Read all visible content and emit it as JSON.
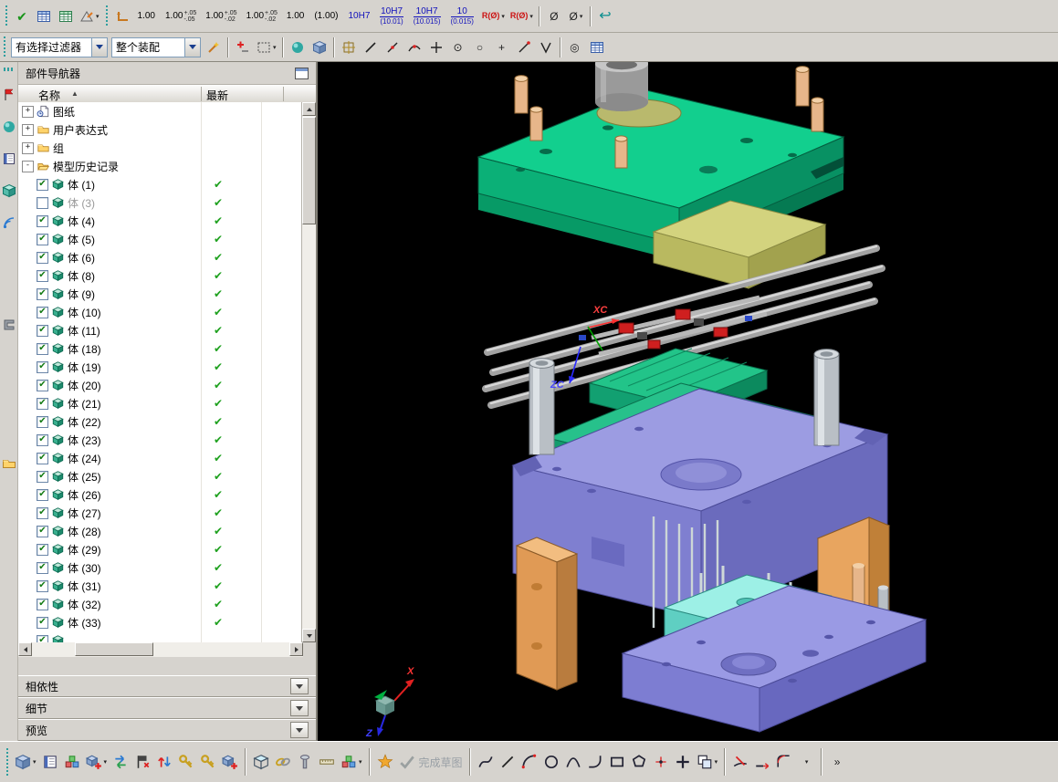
{
  "navigator": {
    "title": "部件导航器",
    "columns": {
      "name": "名称",
      "sort": "▲",
      "latest": "最新"
    },
    "nodes": [
      {
        "expander": "+",
        "icon": "#i-clockpage",
        "label": "图纸"
      },
      {
        "expander": "+",
        "icon": "#i-folder",
        "label": "用户表达式"
      },
      {
        "expander": "+",
        "icon": "#i-folder",
        "label": "组"
      },
      {
        "expander": "-",
        "icon": "#i-folderopen",
        "label": "模型历史记录"
      }
    ],
    "bodies": [
      {
        "label": "体 (1)",
        "mark": "✔",
        "state": "on",
        "latest": "✔"
      },
      {
        "label": "体 (3)",
        "mark": "",
        "state": "off",
        "labcls": "dim",
        "latest": "✔"
      },
      {
        "label": "体 (4)",
        "mark": "✔",
        "state": "on",
        "latest": "✔"
      },
      {
        "label": "体 (5)",
        "mark": "✔",
        "state": "on",
        "latest": "✔"
      },
      {
        "label": "体 (6)",
        "mark": "✔",
        "state": "on",
        "latest": "✔"
      },
      {
        "label": "体 (8)",
        "mark": "✔",
        "state": "on",
        "latest": "✔"
      },
      {
        "label": "体 (9)",
        "mark": "✔",
        "state": "on",
        "latest": "✔"
      },
      {
        "label": "体 (10)",
        "mark": "✔",
        "state": "on",
        "latest": "✔"
      },
      {
        "label": "体 (11)",
        "mark": "✔",
        "state": "on",
        "latest": "✔"
      },
      {
        "label": "体 (18)",
        "mark": "✔",
        "state": "on",
        "latest": "✔"
      },
      {
        "label": "体 (19)",
        "mark": "✔",
        "state": "on",
        "latest": "✔"
      },
      {
        "label": "体 (20)",
        "mark": "✔",
        "state": "on",
        "latest": "✔"
      },
      {
        "label": "体 (21)",
        "mark": "✔",
        "state": "on",
        "latest": "✔"
      },
      {
        "label": "体 (22)",
        "mark": "✔",
        "state": "on",
        "latest": "✔"
      },
      {
        "label": "体 (23)",
        "mark": "✔",
        "state": "on",
        "latest": "✔"
      },
      {
        "label": "体 (24)",
        "mark": "✔",
        "state": "on",
        "latest": "✔"
      },
      {
        "label": "体 (25)",
        "mark": "✔",
        "state": "on",
        "latest": "✔"
      },
      {
        "label": "体 (26)",
        "mark": "✔",
        "state": "on",
        "latest": "✔"
      },
      {
        "label": "体 (27)",
        "mark": "✔",
        "state": "on",
        "latest": "✔"
      },
      {
        "label": "体 (28)",
        "mark": "✔",
        "state": "on",
        "latest": "✔"
      },
      {
        "label": "体 (29)",
        "mark": "✔",
        "state": "on",
        "latest": "✔"
      },
      {
        "label": "体 (30)",
        "mark": "✔",
        "state": "on",
        "latest": "✔"
      },
      {
        "label": "体 (31)",
        "mark": "✔",
        "state": "on",
        "latest": "✔"
      },
      {
        "label": "体 (32)",
        "mark": "✔",
        "state": "on",
        "latest": "✔"
      },
      {
        "label": "体 (33)",
        "mark": "✔",
        "state": "on",
        "latest": "✔"
      },
      {
        "label": "",
        "mark": "✔",
        "state": "on",
        "latest": ""
      }
    ],
    "panels": [
      {
        "label": "相依性"
      },
      {
        "label": "细节"
      },
      {
        "label": "预览"
      }
    ]
  },
  "filters": {
    "selection": "有选择过滤器",
    "scope": "整个装配"
  },
  "viewport": {
    "wcs_xc": "XC",
    "wcs_zc": "ZC",
    "triad_x": "X",
    "triad_z": "Z"
  },
  "toolbars": {
    "row1_lead": [
      {
        "cls": "grip"
      },
      {
        "name": "edit-check-icon",
        "text": "✔",
        "tcls": "t-green"
      },
      {
        "name": "table-icon",
        "glyph": "#i-table"
      },
      {
        "name": "spreadsheet-icon",
        "glyph": "#i-table2"
      },
      {
        "name": "annotation-tools-icon",
        "glyph": "#i-datum",
        "arrow": "▾"
      },
      {
        "cls": "grip"
      },
      {
        "name": "dim-style-icon",
        "glyph": "#i-corner"
      }
    ],
    "tolerances": [
      {
        "main": "1.00"
      },
      {
        "main": "1.00",
        "sup": "+.05",
        "sub": "-.05"
      },
      {
        "main": "1.00",
        "sup": "+.05",
        "sub": "-.02"
      },
      {
        "main": "1.00",
        "sup": "+.05",
        "sub": "-.02"
      },
      {
        "main": "1.00",
        "boxed": "boxed"
      },
      {
        "main": "(1.00)"
      },
      {
        "main": "10H7",
        "blue": "t-blue"
      },
      {
        "main": "10H7",
        "under": "(10.01)",
        "blue": "t-blue"
      },
      {
        "main": "10H7",
        "under": "(10.015)",
        "blue": "t-blue"
      },
      {
        "main": "10",
        "under": "(0.015)",
        "blue": "t-blue"
      }
    ],
    "row1_trail": [
      {
        "name": "radial-dim-icon",
        "text": "R(Ø)",
        "tcls": "t-red",
        "arrow": "▾"
      },
      {
        "name": "radial-dim-alt-icon",
        "text": "R(Ø)",
        "tcls": "t-red",
        "arrow": "▾"
      },
      {
        "cls": "sp"
      },
      {
        "name": "diameter-dim-icon",
        "text": "Ø",
        "tcls": "t-dim"
      },
      {
        "name": "diameter-dim-alt-icon",
        "text": "Ø",
        "tcls": "t-dim",
        "arrow": "▾"
      },
      {
        "cls": "sp"
      },
      {
        "name": "undo-icon",
        "text": "↩",
        "tcls": "t-teal"
      }
    ],
    "row2_lead": [
      {
        "cls": "grip"
      }
    ],
    "row2_icons": [
      {
        "name": "snap-settings-icon",
        "glyph": "#i-wand"
      },
      {
        "cls": "sp"
      },
      {
        "name": "show-hide-icon",
        "glyph": "#i-plusminus"
      },
      {
        "name": "selection-rect-icon",
        "glyph": "#i-dashrect",
        "arrow": "▾"
      },
      {
        "cls": "sp"
      },
      {
        "name": "shaded-sphere-icon",
        "glyph": "#i-sphere"
      },
      {
        "name": "solid-cube-icon",
        "glyph": "#i-cube"
      },
      {
        "cls": "sp"
      },
      {
        "name": "snap-point-icon",
        "glyph": "#i-snap"
      },
      {
        "name": "endpoint-snap-icon",
        "glyph": "#i-line2"
      },
      {
        "name": "midpoint-snap-icon",
        "glyph": "#i-midpoint"
      },
      {
        "name": "point-on-curve-icon",
        "glyph": "#i-curvepoint"
      },
      {
        "name": "intersection-snap-icon",
        "glyph": "#i-axis"
      },
      {
        "name": "arc-center-snap-icon",
        "text": "⊙",
        "tcls": "t-dim"
      },
      {
        "name": "quadrant-snap-icon",
        "text": "○",
        "tcls": "t-dim"
      },
      {
        "name": "existing-point-snap-icon",
        "text": "+",
        "tcls": "t-dim"
      },
      {
        "name": "point-on-line-snap-icon",
        "glyph": "#i-slashdot"
      },
      {
        "name": "two-curves-snap-icon",
        "glyph": "#i-twolines"
      },
      {
        "cls": "sp"
      },
      {
        "name": "magnifier-icon",
        "text": "◎",
        "tcls": "t-dim"
      },
      {
        "name": "grid-snap-icon",
        "glyph": "#i-table"
      }
    ],
    "left_strip": [
      {
        "cls": "hgrip"
      },
      {
        "name": "assembly-navigator-tab-icon",
        "glyph": "#i-flagred"
      },
      {
        "name": "constraint-navigator-tab-icon",
        "glyph": "#i-sphere"
      },
      {
        "name": "notebook-tab-icon",
        "glyph": "#i-book"
      },
      {
        "name": "part-navigator-tab-icon",
        "glyph": "#i-cubeteal"
      },
      {
        "name": "internet-tab-icon",
        "glyph": "#i-signal"
      },
      {
        "cls": "lgap"
      },
      {
        "name": "reuse-library-tab-icon",
        "glyph": "#i-clamp"
      },
      {
        "cls": "lgap2"
      },
      {
        "name": "system-folder-tab-icon",
        "glyph": "#i-folder"
      }
    ],
    "bottom": [
      {
        "cls": "grip"
      },
      {
        "name": "assemblies-icon",
        "glyph": "#i-cube",
        "arrow": "▾"
      },
      {
        "name": "window-icon",
        "glyph": "#i-book"
      },
      {
        "name": "component-view-icon",
        "glyph": "#i-cubes"
      },
      {
        "name": "add-component-icon",
        "glyph": "#i-blockplus",
        "arrow": "▾"
      },
      {
        "name": "replace-component-icon",
        "glyph": "#i-swap"
      },
      {
        "name": "assembly-constraints-icon",
        "glyph": "#i-flag"
      },
      {
        "name": "move-component-icon",
        "glyph": "#i-sort"
      },
      {
        "name": "wave-link-icon",
        "glyph": "#i-key"
      },
      {
        "name": "wave-link-alt-icon",
        "glyph": "#i-key"
      },
      {
        "name": "pattern-component-icon",
        "glyph": "#i-blockplus"
      },
      {
        "cls": "bsep"
      },
      {
        "name": "exploded-view-icon",
        "glyph": "#i-isocube"
      },
      {
        "name": "interpart-links-icon",
        "glyph": "#i-links"
      },
      {
        "name": "fastener-icon",
        "glyph": "#i-pin"
      },
      {
        "name": "measure-icon",
        "glyph": "#i-caliper"
      },
      {
        "name": "sequence-icon",
        "glyph": "#i-cubes",
        "arrow": "▾"
      },
      {
        "cls": "bsep"
      },
      {
        "name": "sketch-icon",
        "glyph": "#i-star"
      },
      {
        "name": "finish-sketch-icon",
        "glyph": "#i-finish",
        "label": "完成草图",
        "labcls": "dim-label"
      },
      {
        "cls": "bsep"
      },
      {
        "name": "studio-spline-icon",
        "glyph": "#i-spline"
      },
      {
        "name": "line-icon",
        "glyph": "#i-line2"
      },
      {
        "name": "arc-icon",
        "glyph": "#i-arc"
      },
      {
        "name": "circle-icon",
        "glyph": "#i-circle"
      },
      {
        "name": "conic-icon",
        "glyph": "#i-conic"
      },
      {
        "name": "fillet-icon",
        "glyph": "#i-fillet"
      },
      {
        "name": "rectangle-icon",
        "glyph": "#i-rect"
      },
      {
        "name": "polygon-icon",
        "glyph": "#i-polygon"
      },
      {
        "name": "point-icon",
        "glyph": "#i-point"
      },
      {
        "name": "plus-icon",
        "glyph": "#i-plusbig"
      },
      {
        "name": "offset-curve-icon",
        "glyph": "#i-copy",
        "arrow": "▾"
      },
      {
        "cls": "bsep"
      },
      {
        "name": "trim-curve-icon",
        "glyph": "#i-trim"
      },
      {
        "name": "extend-curve-icon",
        "glyph": "#i-extend"
      },
      {
        "name": "corner-curve-icon",
        "glyph": "#i-fillet2"
      },
      {
        "name": "more-curves-icon",
        "arrow": "▾"
      },
      {
        "cls": "bsep"
      },
      {
        "name": "toolbar-options-icon",
        "text": "»",
        "tcls": "t-dim"
      }
    ]
  }
}
